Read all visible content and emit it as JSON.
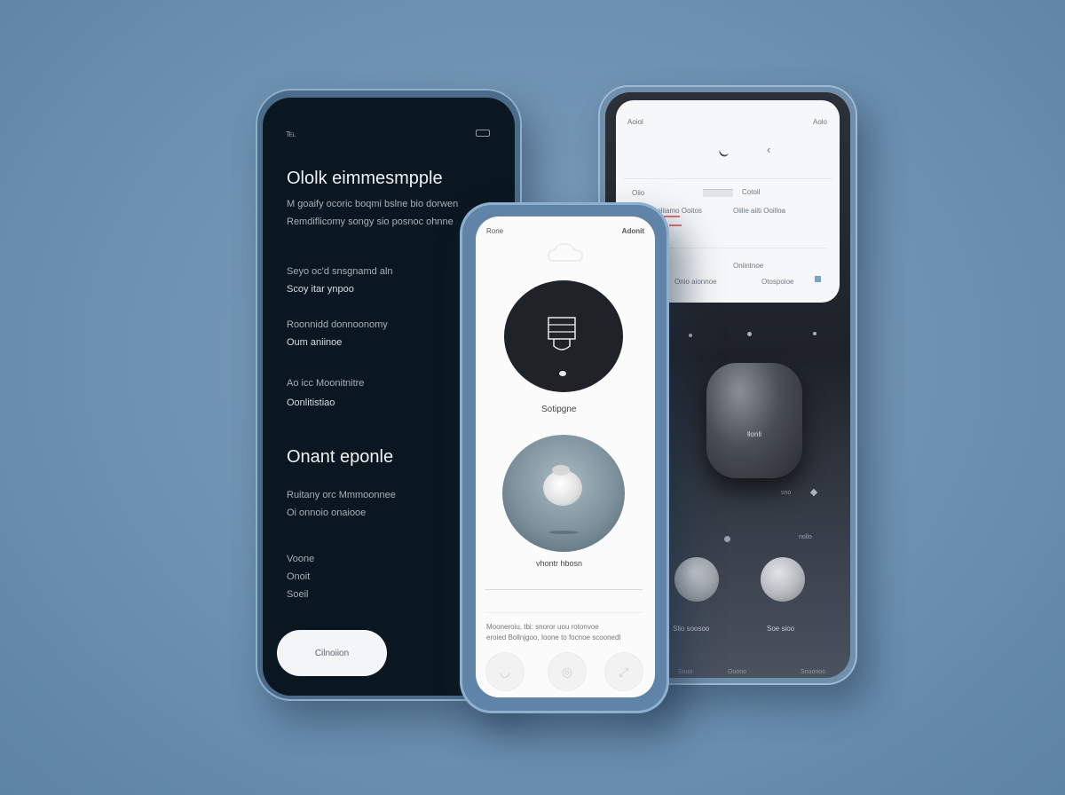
{
  "left_phone": {
    "status_left": "℡",
    "title": "Ololk eimmesmpple",
    "intro": [
      "M goaify ocoric boqmi bslne bio dorwen",
      "Remdiflicomy songy sio posnoc ohnne"
    ],
    "section1": [
      "Seyo oc'd snsgnamd aln",
      "Scoy itar ynpoo"
    ],
    "section2": [
      "Roonnidd donnoonomy",
      "Oum aniinoe"
    ],
    "section3": [
      "Ao icc Moonitnitre",
      "Oonlitistiao"
    ],
    "heading2": "Onant eponle",
    "section4": [
      "Ruitany orc Mmmoonnee",
      "Oi onnoio onaiooe"
    ],
    "section5": [
      "Voone",
      "Onoit",
      "Soeil"
    ],
    "button_label": "Cilnoiion"
  },
  "middle_phone": {
    "status_left": "Rone",
    "status_right": "Adonit",
    "device_caption": "Sotipgne",
    "photo_caption": "vhontr hbosn",
    "footer_text": [
      "Mooneroiu, tbi: snoror uou rotonvoe",
      "eroied Bollnjgoo, Ioone to focnoe scoonedl"
    ]
  },
  "right_phone": {
    "status_left": "Aoiol",
    "status_right": "Aolo",
    "row1_left": "Oiio",
    "row1_right": "Cotoil",
    "row2_left": "Ooliiamo Ooitos",
    "row2_right": "Oiilie aiiti Ooilloa",
    "center_text": "Oniintnoe",
    "row3_left": "Onio aionnoe",
    "row3_right": "Otospoioe",
    "device_label": "llonli",
    "device_corner": "sno",
    "corner_label": "nollo",
    "knob_left_label": "Slio soosoo",
    "knob_right_label": "Soe sioo",
    "bottom_labels": [
      "Snoo",
      "Ooono",
      "Snoonoo"
    ]
  },
  "colors": {
    "background": "#6d91b1",
    "dark_screen": "#0b1720",
    "light_screen": "#fbfbfb",
    "accent_red": "#e46f6f",
    "accent_blue": "#7aa4c3"
  }
}
